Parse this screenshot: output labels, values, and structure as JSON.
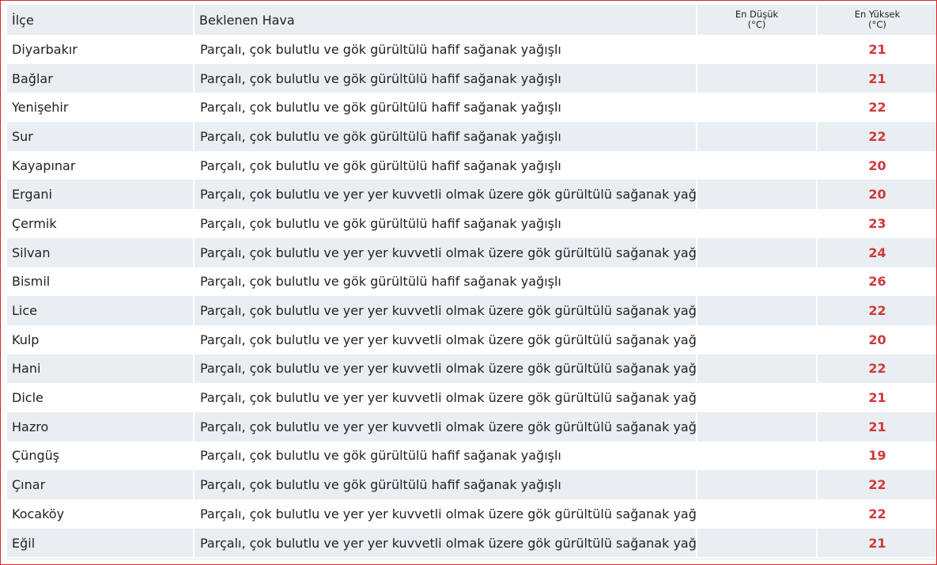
{
  "table": {
    "headers": {
      "district": "İlçe",
      "forecast": "Beklenen Hava",
      "min_title": "En Düşük",
      "min_unit": "(°C)",
      "max_title": "En Yüksek",
      "max_unit": "(°C)"
    },
    "rows": [
      {
        "district": "Diyarbakır",
        "forecast": "Parçalı, çok bulutlu ve gök gürültülü hafif sağanak yağışlı",
        "min": "",
        "max": "21"
      },
      {
        "district": "Bağlar",
        "forecast": "Parçalı, çok bulutlu ve gök gürültülü hafif sağanak yağışlı",
        "min": "",
        "max": "21"
      },
      {
        "district": "Yenişehir",
        "forecast": "Parçalı, çok bulutlu ve gök gürültülü hafif sağanak yağışlı",
        "min": "",
        "max": "22"
      },
      {
        "district": "Sur",
        "forecast": "Parçalı, çok bulutlu ve gök gürültülü hafif sağanak yağışlı",
        "min": "",
        "max": "22"
      },
      {
        "district": "Kayapınar",
        "forecast": "Parçalı, çok bulutlu ve gök gürültülü hafif sağanak yağışlı",
        "min": "",
        "max": "20"
      },
      {
        "district": "Ergani",
        "forecast": "Parçalı, çok bulutlu ve yer yer kuvvetli olmak üzere gök gürültülü sağanak yağışlı",
        "min": "",
        "max": "20"
      },
      {
        "district": "Çermik",
        "forecast": "Parçalı, çok bulutlu ve gök gürültülü hafif sağanak yağışlı",
        "min": "",
        "max": "23"
      },
      {
        "district": "Silvan",
        "forecast": "Parçalı, çok bulutlu ve yer yer kuvvetli olmak üzere gök gürültülü sağanak yağışlı",
        "min": "",
        "max": "24"
      },
      {
        "district": "Bismil",
        "forecast": "Parçalı, çok bulutlu ve gök gürültülü hafif sağanak yağışlı",
        "min": "",
        "max": "26"
      },
      {
        "district": "Lice",
        "forecast": "Parçalı, çok bulutlu ve yer yer kuvvetli olmak üzere gök gürültülü sağanak yağışlı",
        "min": "",
        "max": "22"
      },
      {
        "district": "Kulp",
        "forecast": "Parçalı, çok bulutlu ve yer yer kuvvetli olmak üzere gök gürültülü sağanak yağışlı",
        "min": "",
        "max": "20"
      },
      {
        "district": "Hani",
        "forecast": "Parçalı, çok bulutlu ve yer yer kuvvetli olmak üzere gök gürültülü sağanak yağışlı",
        "min": "",
        "max": "22"
      },
      {
        "district": "Dicle",
        "forecast": "Parçalı, çok bulutlu ve yer yer kuvvetli olmak üzere gök gürültülü sağanak yağışlı",
        "min": "",
        "max": "21"
      },
      {
        "district": "Hazro",
        "forecast": "Parçalı, çok bulutlu ve yer yer kuvvetli olmak üzere gök gürültülü sağanak yağışlı",
        "min": "",
        "max": "21"
      },
      {
        "district": "Çüngüş",
        "forecast": "Parçalı, çok bulutlu ve gök gürültülü hafif sağanak yağışlı",
        "min": "",
        "max": "19"
      },
      {
        "district": "Çınar",
        "forecast": "Parçalı, çok bulutlu ve gök gürültülü hafif sağanak yağışlı",
        "min": "",
        "max": "22"
      },
      {
        "district": "Kocaköy",
        "forecast": "Parçalı, çok bulutlu ve yer yer kuvvetli olmak üzere gök gürültülü sağanak yağışlı",
        "min": "",
        "max": "22"
      },
      {
        "district": "Eğil",
        "forecast": "Parçalı, çok bulutlu ve yer yer kuvvetli olmak üzere gök gürültülü sağanak yağışlı",
        "min": "",
        "max": "21"
      }
    ]
  },
  "colors": {
    "border": "#d7262b",
    "stripe": "#e8eef1",
    "max_temp": "#d0383c",
    "min_temp": "#2a73b8",
    "text": "#222222"
  }
}
